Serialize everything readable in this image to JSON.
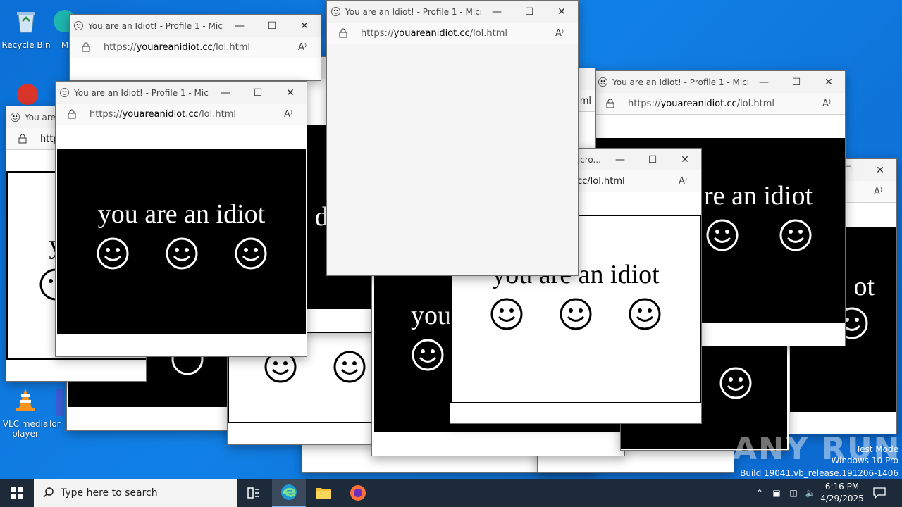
{
  "desktop": {
    "icons": [
      {
        "label": "Recycle Bin"
      },
      {
        "label": "M"
      },
      {
        "label": "VLC media player"
      },
      {
        "label": "lor"
      }
    ]
  },
  "window": {
    "title": "You are an Idiot! - Profile 1 - Micro...",
    "title_short": "You are",
    "title_tail": "Micro...",
    "url_scheme": "https://",
    "url_host": "youareanidiot.cc",
    "url_path": "/lol.html",
    "url_partial": "cc/lol.html",
    "url_fragment": "http",
    "url_tail": "ml",
    "read_aloud_glyph": "A⁾"
  },
  "content": {
    "idiot_text": "you are an idiot",
    "idiot_partial_1": "di",
    "idiot_partial_2": "y",
    "idiot_partial_3": "you",
    "idiot_partial_4": "re an idiot",
    "idiot_partial_5": "ot"
  },
  "taskbar": {
    "search_placeholder": "Type here to search",
    "time": "6:16 PM",
    "date": "4/29/2025"
  },
  "watermark": {
    "line1": "Test Mode",
    "line2": "Windows 10 Pro",
    "line3": "Build 19041.vb_release.191206-1406",
    "brand": "ANY RUN"
  },
  "colors": {
    "desktop": "#0a6fd6",
    "taskbar": "#1c2a3a"
  }
}
